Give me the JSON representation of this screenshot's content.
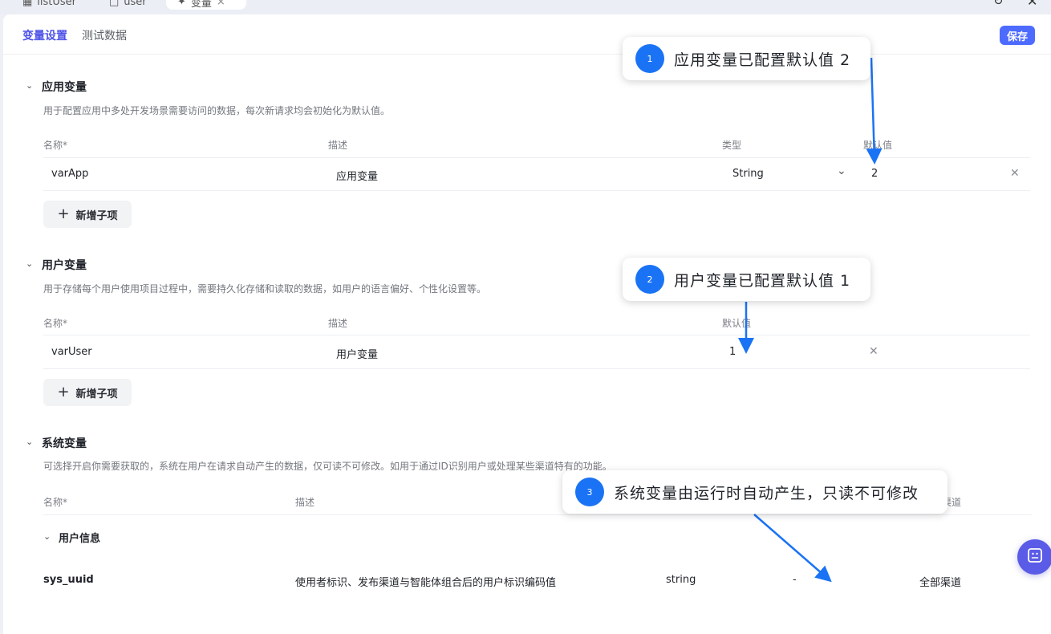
{
  "tabs": [
    {
      "label": "listUser",
      "icon": "grid-icon"
    },
    {
      "label": "user",
      "icon": "file-icon"
    },
    {
      "label": "变量",
      "icon": "variable-icon",
      "active": true
    }
  ],
  "subnav": {
    "active": "变量设置",
    "second": "测试数据",
    "save": "保存"
  },
  "app_section": {
    "title": "应用变量",
    "desc": "用于配置应用中多处开发场景需要访问的数据，每次新请求均会初始化为默认值。",
    "columns": [
      "名称*",
      "描述",
      "类型",
      "默认值"
    ],
    "row": {
      "name": "varApp",
      "desc": "应用变量",
      "type": "String",
      "default": "2"
    },
    "add": "新增子项"
  },
  "user_section": {
    "title": "用户变量",
    "desc": "用于存储每个用户使用项目过程中，需要持久化存储和读取的数据，如用户的语言偏好、个性化设置等。",
    "columns": [
      "名称*",
      "描述",
      "默认值"
    ],
    "row": {
      "name": "varUser",
      "desc": "用户变量",
      "default": "1"
    },
    "add": "新增子项"
  },
  "sys_section": {
    "title": "系统变量",
    "desc": "可选择开启你需要获取的，系统在用户在请求自动产生的数据，仅可读不可修改。如用于通过ID识别用户或处理某些渠道特有的功能。",
    "columns": [
      "名称*",
      "描述",
      "渠道"
    ],
    "group": "用户信息",
    "row": {
      "name": "sys_uuid",
      "desc": "使用者标识、发布渠道与智能体组合后的用户标识编码值",
      "type": "string",
      "default": "-",
      "channel": "全部渠道"
    }
  },
  "callouts": [
    {
      "num": "1",
      "text": "应用变量已配置默认值 2"
    },
    {
      "num": "2",
      "text": "用户变量已配置默认值 1"
    },
    {
      "num": "3",
      "text": "系统变量由运行时自动产生，只读不可修改"
    }
  ],
  "colors": {
    "accent": "#4d53e8",
    "save": "#4d6bfe",
    "callout_badge": "#1a73f5",
    "arrow": "#1a73f5"
  }
}
